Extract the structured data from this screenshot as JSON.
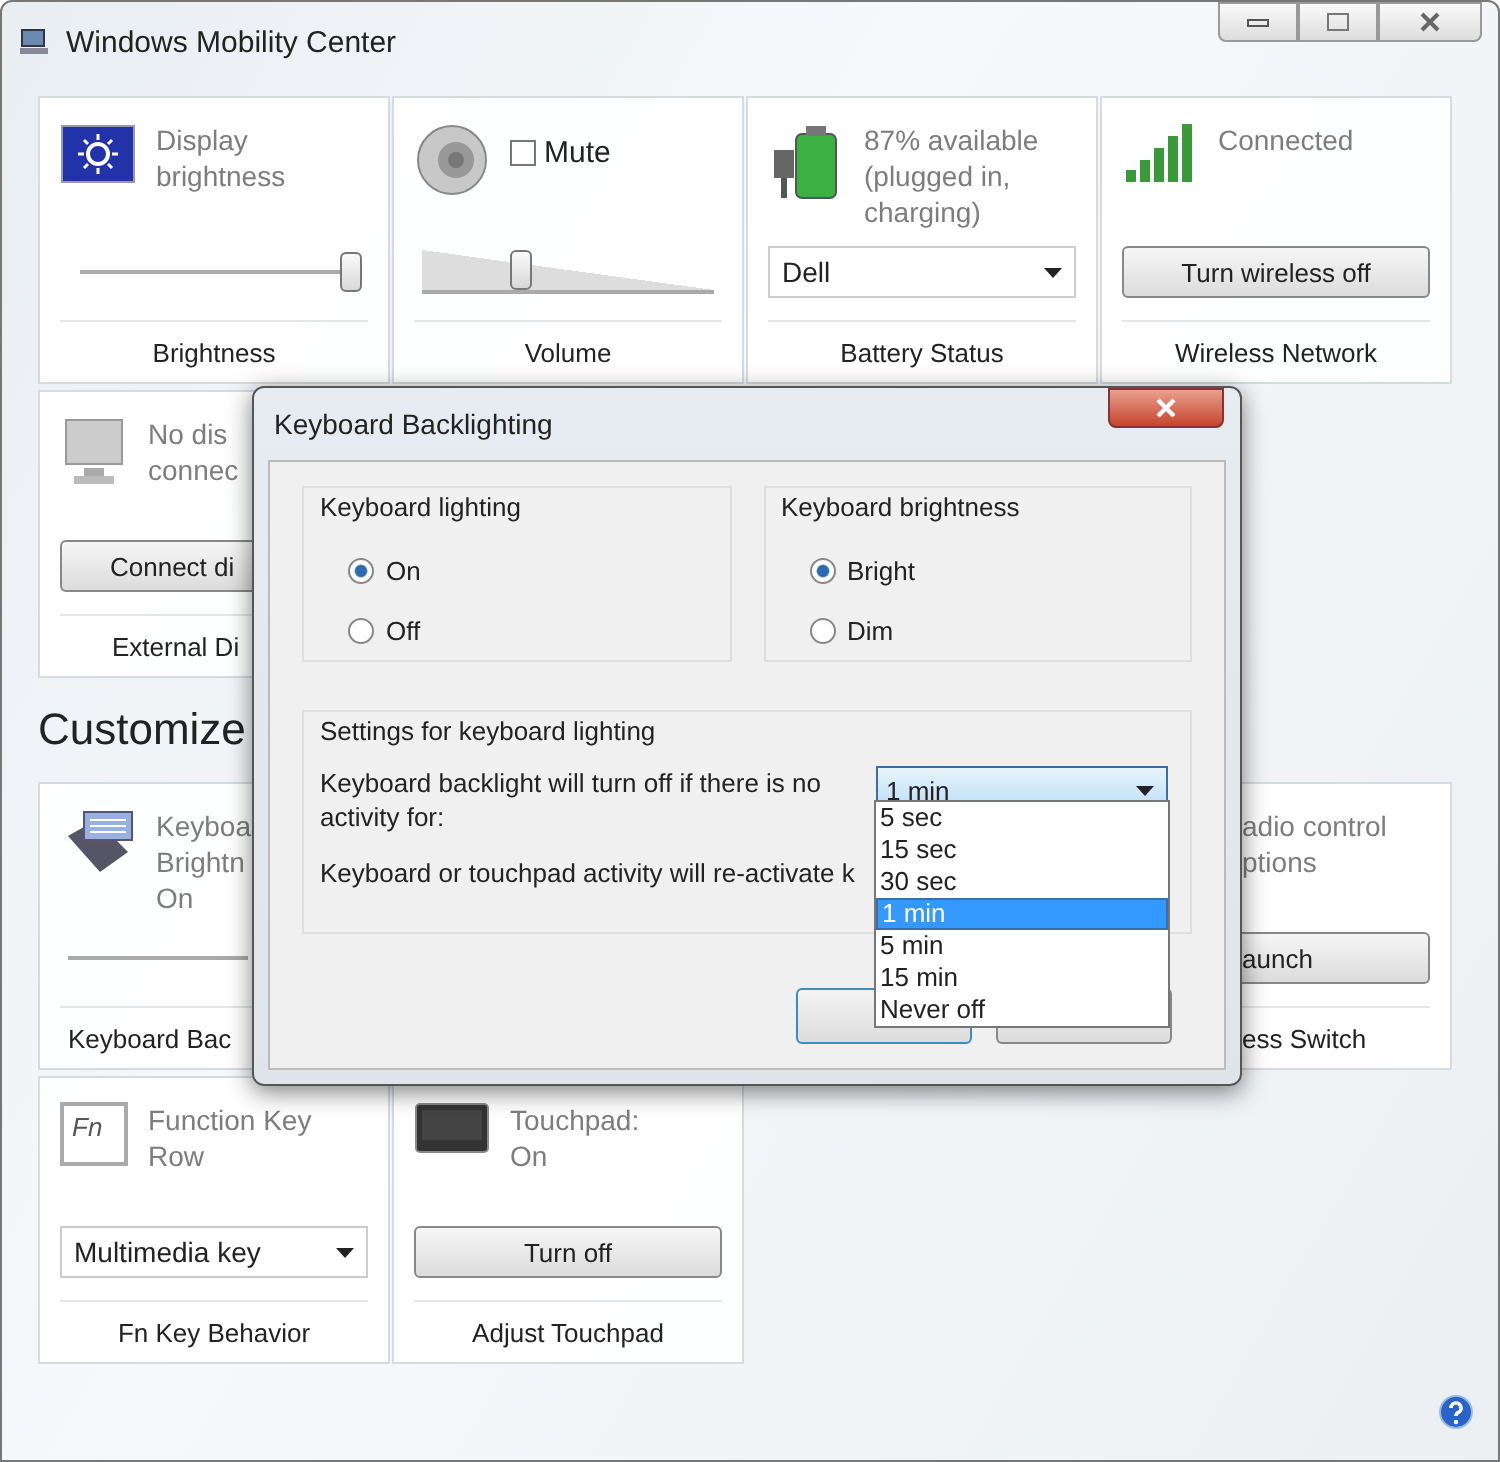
{
  "window": {
    "title": "Windows Mobility Center"
  },
  "top_tiles": [
    {
      "kind": "slider",
      "status": "Display\nbrightness",
      "level": 0.97,
      "title": "Brightness"
    },
    {
      "kind": "volume",
      "mute_label": "Mute",
      "muted": false,
      "level": 0.34,
      "title": "Volume"
    },
    {
      "kind": "dropdown",
      "status": "87% available\n(plugged in,\ncharging)",
      "value": "Dell",
      "title": "Battery Status"
    },
    {
      "kind": "button",
      "status": "Connected",
      "button": "Turn wireless off",
      "title": "Wireless Network"
    }
  ],
  "second_tiles": [
    {
      "kind": "button",
      "status": "No dis\nconnec",
      "button": "Connect di",
      "title": "External Di"
    }
  ],
  "heading": "Customize",
  "custom_tiles": [
    {
      "kind": "slider",
      "status": "Keyboa\nBrightn\nOn",
      "title": "Keyboard Bac"
    },
    {
      "kind": "button",
      "status": "adio control\nptions",
      "button": "aunch",
      "title": "ess Switch"
    }
  ],
  "bottom_tiles": [
    {
      "kind": "dropdown",
      "icon_text": "Fn",
      "status": "Function Key\nRow",
      "value": "Multimedia key",
      "title": "Fn Key Behavior"
    },
    {
      "kind": "button",
      "status": "Touchpad:\nOn",
      "button": "Turn off",
      "title": "Adjust Touchpad"
    }
  ],
  "dialog": {
    "title": "Keyboard Backlighting",
    "groups": [
      {
        "title": "Keyboard lighting",
        "options": [
          {
            "label": "On",
            "selected": true
          },
          {
            "label": "Off",
            "selected": false
          }
        ]
      },
      {
        "title": "Keyboard brightness",
        "options": [
          {
            "label": "Bright",
            "selected": true
          },
          {
            "label": "Dim",
            "selected": false
          }
        ]
      }
    ],
    "settings": {
      "title": "Settings for keyboard lighting",
      "prompt": "Keyboard backlight will turn off if there is no activity for:",
      "value": "1 min",
      "note": "Keyboard or touchpad activity will re-activate k",
      "options": [
        {
          "label": "5 sec",
          "selected": false
        },
        {
          "label": "15 sec",
          "selected": false
        },
        {
          "label": "30 sec",
          "selected": false
        },
        {
          "label": "1 min",
          "selected": true
        },
        {
          "label": "5 min",
          "selected": false
        },
        {
          "label": "15 min",
          "selected": false
        },
        {
          "label": "Never off",
          "selected": false
        }
      ]
    }
  }
}
